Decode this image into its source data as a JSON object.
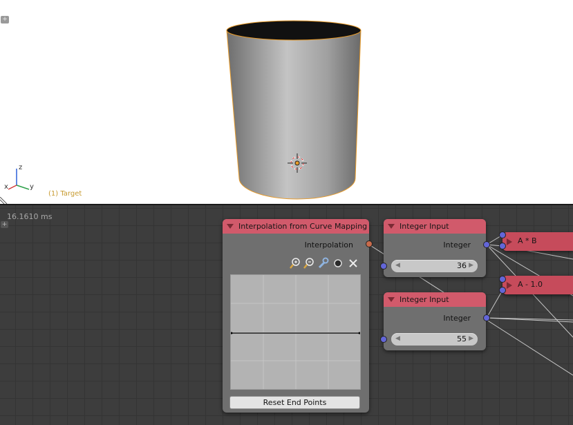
{
  "viewport": {
    "object_label": "(1) Target",
    "corner_button": "+",
    "axis": {
      "x": "x",
      "y": "y",
      "z": "z"
    },
    "colors": {
      "selection_outline": "#e89b2a",
      "object_label": "#c79a2f"
    }
  },
  "editor": {
    "timing": "16.1610 ms",
    "corner_button": "+"
  },
  "nodes": {
    "curve_node": {
      "title": "Interpolation from Curve Mapping",
      "output_label": "Interpolation",
      "reset_label": "Reset End Points",
      "toolbar_icons": [
        "zoom-in-icon",
        "zoom-out-icon",
        "wrench-icon",
        "circle-icon",
        "close-icon"
      ]
    },
    "integer_input_1": {
      "title": "Integer Input",
      "output_label": "Integer",
      "value": "36"
    },
    "integer_input_2": {
      "title": "Integer Input",
      "output_label": "Integer",
      "value": "55"
    },
    "math_1": {
      "title": "A * B"
    },
    "math_2": {
      "title": "A - 1.0"
    }
  },
  "colors": {
    "node_header": "#d15a6b",
    "node_body": "#6f6f6f",
    "socket_integer": "#6366d8",
    "socket_interpolation": "#c86b4c",
    "editor_background": "#3d3d3d"
  }
}
